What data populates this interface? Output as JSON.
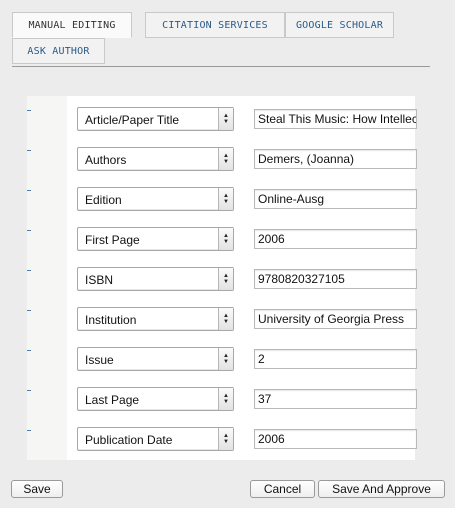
{
  "tabs": [
    {
      "label": "MANUAL EDITING",
      "active": true
    },
    {
      "label": "CITATION SERVICES",
      "active": false
    },
    {
      "label": "GOOGLE SCHOLAR",
      "active": false
    },
    {
      "label": "ASK AUTHOR",
      "active": false
    }
  ],
  "fields": [
    {
      "field": "Article/Paper Title",
      "value": "Steal This Music: How Intellect"
    },
    {
      "field": "Authors",
      "value": "Demers, (Joanna)"
    },
    {
      "field": "Edition",
      "value": "Online-Ausg"
    },
    {
      "field": "First Page",
      "value": "2006"
    },
    {
      "field": "ISBN",
      "value": "9780820327105"
    },
    {
      "field": "Institution",
      "value": "University of Georgia Press"
    },
    {
      "field": "Issue",
      "value": "2"
    },
    {
      "field": "Last Page",
      "value": "37"
    },
    {
      "field": "Publication Date",
      "value": "2006"
    }
  ],
  "buttons": {
    "save": "Save",
    "cancel": "Cancel",
    "save_and_approve": "Save And Approve"
  },
  "colors": {
    "tab_text": "#2a5a8a",
    "accent_mark": "#4a7dab"
  }
}
